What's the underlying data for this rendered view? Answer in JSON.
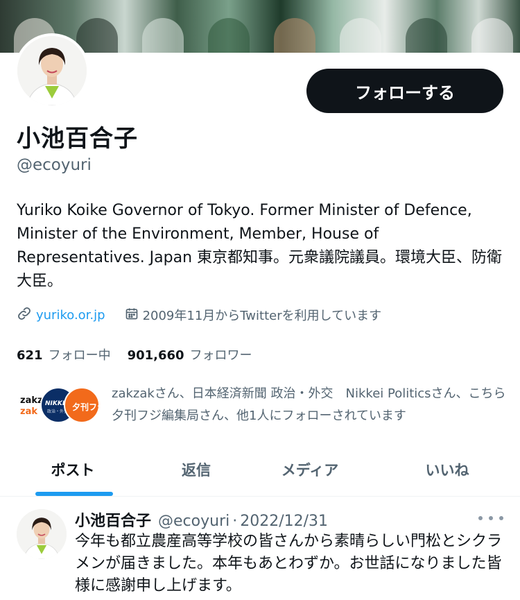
{
  "profile": {
    "name": "小池百合子",
    "handle": "@ecoyuri",
    "follow_label": "フォローする",
    "bio": "Yuriko Koike Governor of Tokyo. Former Minister of Defence, Minister of the Environment, Member, House of Representatives. Japan 東京都知事。元衆議院議員。環境大臣、防衛大臣。",
    "website": "yuriko.or.jp",
    "joined": "2009年11月からTwitterを利用しています",
    "following_count": "621",
    "following_label": "フォロー中",
    "followers_count": "901,660",
    "followers_label": "フォロワー",
    "followed_by": "zakzakさん、日本経済新聞 政治・外交　Nikkei Politicsさん、こちら夕刊フジ編集局さん、他1人にフォローされています",
    "followed_by_icons": {
      "zakzak": "zakzak",
      "nikkei": "NIKKEI",
      "nikkei_sub": "政治・外交",
      "fuji": "夕刊フジ"
    }
  },
  "tabs": [
    "ポスト",
    "返信",
    "メディア",
    "いいね"
  ],
  "active_tab": "ポスト",
  "post": {
    "name": "小池百合子",
    "handle": "@ecoyuri",
    "separator": "·",
    "date": "2022/12/31",
    "text": "今年も都立農産高等学校の皆さんから素晴らしい門松とシクラメンが届きました。本年もあとわずか。お世話になりました皆様に感謝申し上げます。"
  },
  "colors": {
    "accent": "#1d9bf0",
    "text_primary": "#0f1419",
    "text_secondary": "#536471",
    "follow_button_bg": "#0f1419",
    "fuji_orange": "#f26a1b"
  },
  "icons": {
    "website": "link-icon",
    "joined": "calendar-icon",
    "more": "ellipsis-icon"
  }
}
